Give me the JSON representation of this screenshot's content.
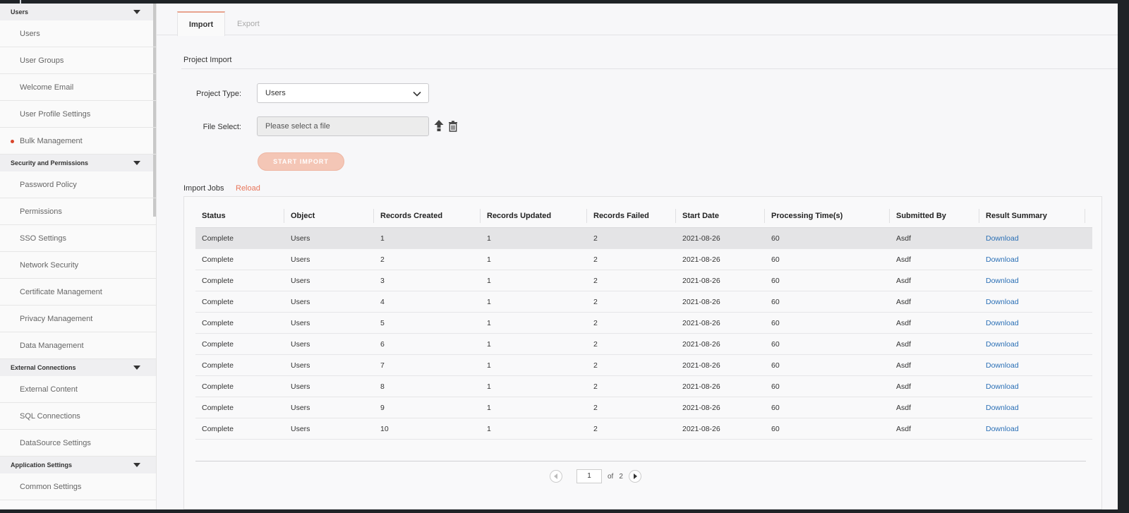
{
  "sidebar": {
    "groups": [
      {
        "title": "Users",
        "items": [
          "Users",
          "User Groups",
          "Welcome Email",
          "User Profile Settings",
          "Bulk Management"
        ]
      },
      {
        "title": "Security and Permissions",
        "items": [
          "Password Policy",
          "Permissions",
          "SSO Settings",
          "Network Security",
          "Certificate Management",
          "Privacy Management",
          "Data Management"
        ]
      },
      {
        "title": "External Connections",
        "items": [
          "External Content",
          "SQL Connections",
          "DataSource Settings"
        ]
      },
      {
        "title": "Application Settings",
        "items": [
          "Common Settings"
        ]
      }
    ],
    "active_item": "Bulk Management"
  },
  "tabs": {
    "import": "Import",
    "export": "Export"
  },
  "project_import": {
    "title": "Project Import",
    "project_type_label": "Project Type:",
    "project_type_value": "Users",
    "file_select_label": "File Select:",
    "file_placeholder": "Please select a file",
    "start_button": "START IMPORT"
  },
  "jobs": {
    "title": "Import Jobs",
    "reload": "Reload",
    "columns": [
      "Status",
      "Object",
      "Records Created",
      "Records Updated",
      "Records Failed",
      "Start Date",
      "Processing Time(s)",
      "Submitted By",
      "Result Summary"
    ],
    "rows": [
      [
        "Complete",
        "Users",
        "1",
        "1",
        "2",
        "2021-08-26",
        "60",
        "Asdf",
        "Download"
      ],
      [
        "Complete",
        "Users",
        "2",
        "1",
        "2",
        "2021-08-26",
        "60",
        "Asdf",
        "Download"
      ],
      [
        "Complete",
        "Users",
        "3",
        "1",
        "2",
        "2021-08-26",
        "60",
        "Asdf",
        "Download"
      ],
      [
        "Complete",
        "Users",
        "4",
        "1",
        "2",
        "2021-08-26",
        "60",
        "Asdf",
        "Download"
      ],
      [
        "Complete",
        "Users",
        "5",
        "1",
        "2",
        "2021-08-26",
        "60",
        "Asdf",
        "Download"
      ],
      [
        "Complete",
        "Users",
        "6",
        "1",
        "2",
        "2021-08-26",
        "60",
        "Asdf",
        "Download"
      ],
      [
        "Complete",
        "Users",
        "7",
        "1",
        "2",
        "2021-08-26",
        "60",
        "Asdf",
        "Download"
      ],
      [
        "Complete",
        "Users",
        "8",
        "1",
        "2",
        "2021-08-26",
        "60",
        "Asdf",
        "Download"
      ],
      [
        "Complete",
        "Users",
        "9",
        "1",
        "2",
        "2021-08-26",
        "60",
        "Asdf",
        "Download"
      ],
      [
        "Complete",
        "Users",
        "10",
        "1",
        "2",
        "2021-08-26",
        "60",
        "Asdf",
        "Download"
      ]
    ],
    "pager": {
      "page": "1",
      "of_label": "of",
      "total": "2"
    }
  },
  "colors": {
    "accent": "#e8765b",
    "link": "#2a6fb5",
    "active_dot": "#d9452b"
  },
  "icons": [
    "chevron-down-icon",
    "upload-icon",
    "trash-icon",
    "caret-down-icon",
    "prev-page-icon",
    "next-page-icon"
  ]
}
